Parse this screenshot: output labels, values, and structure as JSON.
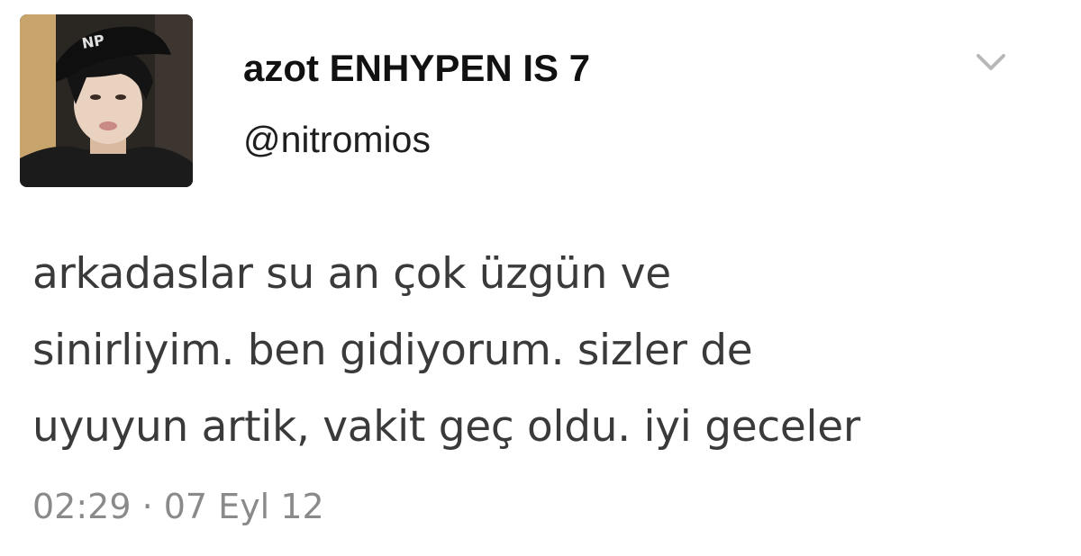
{
  "user": {
    "display_name": "azot ENHYPEN IS 7",
    "handle": "@nitromios"
  },
  "tweet": {
    "lines": [
      "arkadaslar su an çok üzgün ve",
      "sinirliyim. ben gidiyorum. sizler de",
      "uyuyun artik, vakit geç oldu. iyi geceler"
    ],
    "timestamp": "02:29 · 07 Eyl 12"
  },
  "icons": {
    "menu": "chevron-down-icon",
    "avatar": "profile-photo"
  },
  "colors": {
    "name": "#111111",
    "text": "#3a3a3a",
    "timestamp": "#8a8a8a",
    "chevron": "#b8b8b8"
  }
}
